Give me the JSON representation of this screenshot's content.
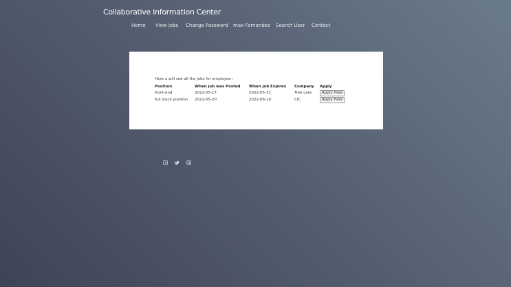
{
  "header": {
    "title": "Collaborative Information Center"
  },
  "nav": {
    "items": [
      {
        "label": "Home"
      },
      {
        "label": "View jobs"
      },
      {
        "label": "Change Password"
      },
      {
        "label": "max Fernandez"
      },
      {
        "label": "Search User"
      },
      {
        "label": "Contact"
      }
    ]
  },
  "jobs": {
    "intro": "Here u will see all the jobs for employee :",
    "columns": [
      "Position",
      "When job was Posted",
      "When job Expires",
      "Company",
      "Apply"
    ],
    "rows": [
      {
        "position": "front-end",
        "posted": "2022-05-17",
        "expires": "2022-05-31",
        "company": "Tree care",
        "apply_label": "Apply Here"
      },
      {
        "position": "full stack position",
        "posted": "2022-05-20",
        "expires": "2022-06-10",
        "company": "CIC",
        "apply_label": "Apply Here"
      }
    ]
  },
  "footer": {
    "social_icons": [
      "facebook-icon",
      "twitter-icon",
      "instagram-icon"
    ]
  },
  "colors": {
    "background_start": "#3f4358",
    "background_end": "#6a7b8a",
    "panel": "#ffffff",
    "text_light": "#ffffff"
  }
}
